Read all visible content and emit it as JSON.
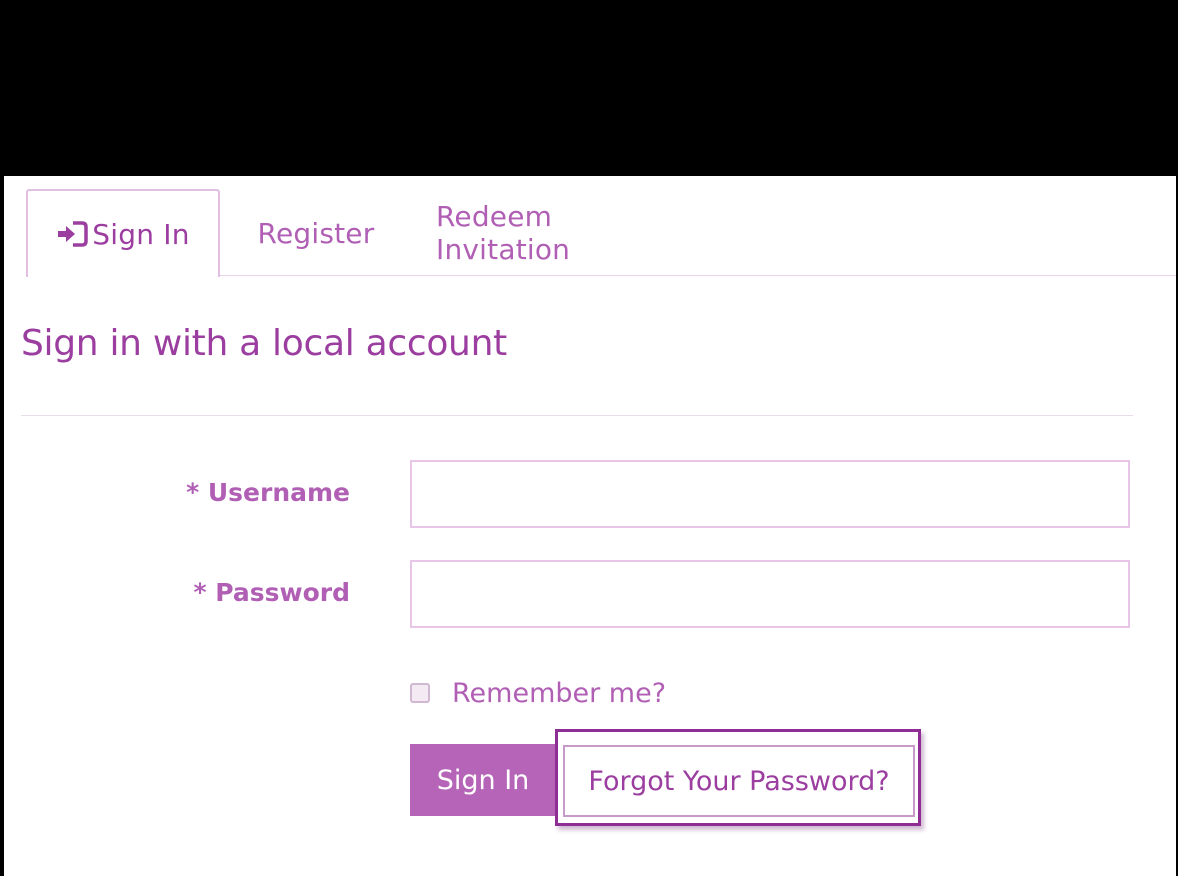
{
  "tabs": [
    {
      "label": "Sign In",
      "icon": "sign-in-icon",
      "active": true
    },
    {
      "label": "Register",
      "active": false
    },
    {
      "label": "Redeem Invitation",
      "active": false
    }
  ],
  "heading": "Sign in with a local account",
  "form": {
    "username": {
      "label": "* Username",
      "value": "",
      "placeholder": ""
    },
    "password": {
      "label": "* Password",
      "value": "",
      "placeholder": ""
    },
    "remember_label": "Remember me?",
    "remember_checked": false,
    "signin_label": "Sign In",
    "forgot_label": "Forgot Your Password?"
  },
  "colors": {
    "accent": "#b564b7",
    "text": "#9b3ea0",
    "highlight": "#8e2e94",
    "border": "#e7c6e8"
  }
}
